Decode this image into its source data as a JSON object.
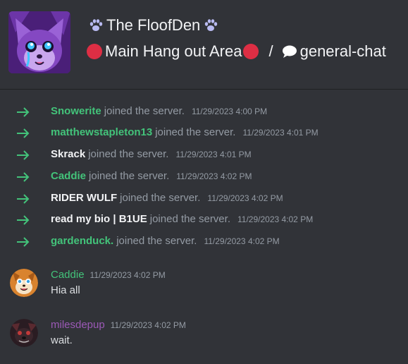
{
  "header": {
    "server_name": "The FloofDen",
    "channel_category": "Main Hang out Area",
    "separator": "/",
    "channel_name": "general-chat"
  },
  "join_messages": [
    {
      "username": "Snowerite",
      "color": "#43c37a",
      "text": "joined the server.",
      "timestamp": "11/29/2023 4:00 PM"
    },
    {
      "username": "matthewstapleton13",
      "color": "#43c37a",
      "text": "joined the server.",
      "timestamp": "11/29/2023 4:01 PM"
    },
    {
      "username": "Skrack",
      "color": "#f2f3f5",
      "text": "joined the server.",
      "timestamp": "11/29/2023 4:01 PM"
    },
    {
      "username": "Caddie",
      "color": "#43c37a",
      "text": "joined the server.",
      "timestamp": "11/29/2023 4:02 PM"
    },
    {
      "username": "RIDER WULF",
      "color": "#f2f3f5",
      "text": "joined the server.",
      "timestamp": "11/29/2023 4:02 PM"
    },
    {
      "username": "read my bio | B1UE",
      "color": "#f2f3f5",
      "text": "joined the server.",
      "timestamp": "11/29/2023 4:02 PM"
    },
    {
      "username": "gardenduck.",
      "color": "#43c37a",
      "text": "joined the server.",
      "timestamp": "11/29/2023 4:02 PM"
    }
  ],
  "messages": [
    {
      "author": "Caddie",
      "author_color": "#43c37a",
      "timestamp": "11/29/2023 4:02 PM",
      "text": "Hia all",
      "avatar_icon": "fox-avatar"
    },
    {
      "author": "milesdepup",
      "author_color": "#9b59b6",
      "timestamp": "11/29/2023 4:02 PM",
      "text": "wait.",
      "avatar_icon": "dark-pup-avatar"
    }
  ],
  "colors": {
    "background": "#313338",
    "join_arrow": "#43c37a",
    "muted_text": "#949ba4"
  }
}
